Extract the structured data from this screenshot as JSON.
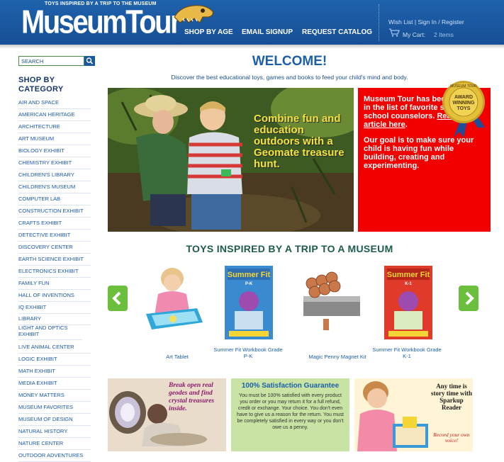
{
  "header": {
    "tagline": "TOYS INSPIRED BY A TRIP TO THE MUSEUM",
    "logo": "MuseumTour",
    "nav": [
      "SHOP BY AGE",
      "EMAIL SIGNUP",
      "REQUEST CATALOG"
    ],
    "wishlist": "Wish List",
    "sign_in": "Sign In",
    "register": "Register",
    "cart_label": "My Cart:",
    "cart_count": "2 Items"
  },
  "sidebar": {
    "search_placeholder": "SEARCH",
    "title": "SHOP BY CATEGORY",
    "categories": [
      "AIR AND SPACE",
      "AMERICAN HERITAGE",
      "ARCHITECTURE",
      "ART MUSEUM",
      "BIOLOGY EXHIBIT",
      "CHEMISTRY EXHIBIT",
      "CHILDREN'S LIBRARY",
      "CHILDREN'S MUSEUM",
      "COMPUTER LAB",
      "CONSTRUCTION EXHIBIT",
      "CRAFTS EXHIBIT",
      "DETECTIVE EXHIBIT",
      "DISCOVERY CENTER",
      "EARTH SCIENCE EXHIBIT",
      "ELECTRONICS EXHIBIT",
      "FAMILY FUN",
      "HALL OF INVENTIONS",
      "IQ EXHIBIT",
      "LIBRARY",
      "LIGHT AND OPTICS EXHIBIT",
      "LIVE ANIMAL CENTER",
      "LOGIC EXHIBIT",
      "MATH EXHIBIT",
      "MEDIA EXHIBIT",
      "MONEY MATTERS",
      "MUSEUM FAVORITES",
      "MUSEUM OF DESIGN",
      "NATURAL HISTORY",
      "NATURE CENTER",
      "OUTDOOR ADVENTURES"
    ]
  },
  "main": {
    "welcome": "WELCOME!",
    "subtitle": "Discover the best educational toys, games and books to feed your child's mind and body.",
    "hero_text": "Combine fun and education outdoors with a Geomate treasure hunt.",
    "red_box": {
      "p1_before": "Museum Tour has been featured in the list of favorite sites for school counselors.",
      "p1_link": "Read the article here",
      "p1_after": ".",
      "p2": "Our goal is to make sure your child is having fun while building, creating and experimenting."
    },
    "award": {
      "ring": "MUSEUM TOUR",
      "line1": "AWARD",
      "line2": "WINNING",
      "line3": "TOYS"
    },
    "toys_heading": "TOYS INSPIRED BY A TRIP TO A MUSEUM",
    "products": [
      "Art Tablet",
      "Summer Fit Workbook Grade P-K",
      "Magic Penny Magnet Kit",
      "Summer Fit Workbook Grade K-1"
    ],
    "book_title": "Summer Fit",
    "book_grades": [
      "P-K",
      "K-1"
    ]
  },
  "promos": {
    "geode": "Break open real geodes and find crystal treasures inside.",
    "guarantee_title": "100% Satisfaction Guarantee",
    "guarantee_body": "You must be 100% satisfied with every product you order or you may return it for a full refund, credit or exchange. Your choice. You don't even have to give us a reason for the return. You must be completely satisfied in every way or you don't owe us a penny.",
    "story": "Any time is story time with Sparkup Reader",
    "story_sub": "Record your own voice!"
  },
  "colors": {
    "header_blue": "#1f62ad",
    "link_blue": "#1a58a8",
    "red_box": "#f20000",
    "arrow_green": "#6cbf3c",
    "hero_yellow": "#f2e33c"
  }
}
